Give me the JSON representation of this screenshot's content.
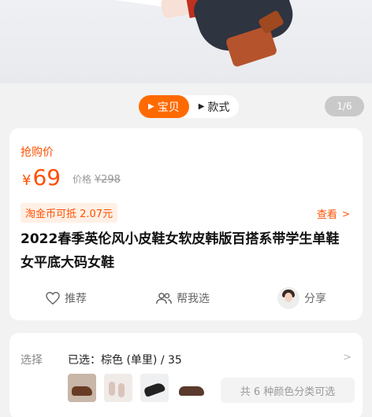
{
  "switcher": {
    "tabs": [
      {
        "label": "宝贝",
        "active": true
      },
      {
        "label": "款式",
        "active": false
      }
    ],
    "pager": "1/6"
  },
  "price_card": {
    "label": "抢购价",
    "currency": "¥",
    "price": "69",
    "orig_label": "价格",
    "orig_price": "¥298",
    "coin_text": "淘金币可抵 2.07元",
    "view_label": "查看",
    "title": "2022春季英伦风小皮鞋女软皮韩版百搭系带学生单鞋女平底大码女鞋",
    "actions": {
      "recommend": "推荐",
      "help_choose": "帮我选",
      "share": "分享"
    }
  },
  "selection": {
    "label": "选择",
    "value": "已选：棕色 (单里) / 35",
    "more_text": "共 6 种颜色分类可选"
  },
  "colors": {
    "accent": "#ff5000",
    "tab_active": "#ff6a00"
  }
}
